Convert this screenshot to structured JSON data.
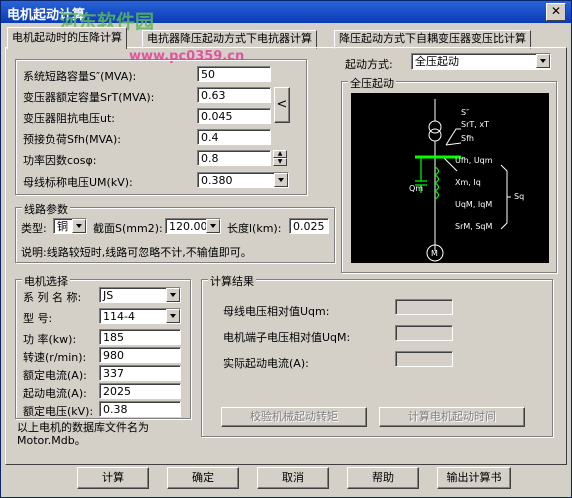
{
  "window": {
    "title": "电机起动计算",
    "close_glyph": "✕"
  },
  "watermark": {
    "text": "河东软件园",
    "url": "www.pc0359.cn"
  },
  "tabs": [
    {
      "label": "电机起动时的压降计算",
      "active": true
    },
    {
      "label": "电抗器降压起动方式下电抗器计算",
      "active": false
    },
    {
      "label": "降压起动方式下自耦变压器变压比计算",
      "active": false
    }
  ],
  "params": {
    "short_circuit_label": "系统短路容量S″(MVA):",
    "short_circuit_value": "50",
    "transformer_cap_label": "变压器额定容量SrT(MVA):",
    "transformer_cap_value": "0.63",
    "transformer_imp_label": "变压器阻抗电压ut:",
    "transformer_imp_value": "0.045",
    "preload_label": "预接负荷Sfh(MVA):",
    "preload_value": "0.4",
    "power_factor_label": "功率因数cosφ:",
    "power_factor_value": "0.8",
    "bus_voltage_label": "母线标称电压UM(kV):",
    "bus_voltage_value": "0.380",
    "side_button": "<"
  },
  "start_mode": {
    "label": "起动方式:",
    "value": "全压起动",
    "group_title": "全压起动"
  },
  "diagram_labels": {
    "s": "S″",
    "srt": "SrT, xT",
    "sfh": "Sfh",
    "ufh": "Ufh, Uqm",
    "xm": "Xm, Iq",
    "uqm": "UqM, IqM",
    "srm": "SrM, SqM",
    "sq": "Sq",
    "qm": "Qm",
    "m": "M"
  },
  "line": {
    "group_title": "线路参数",
    "type_label": "类型:",
    "type_value": "铜",
    "section_label": "截面S(mm2):",
    "section_value": "120.00",
    "length_label": "长度l(km):",
    "length_value": "0.025",
    "note": "说明:线路较短时,线路可忽略不计,不输值即可。"
  },
  "motor": {
    "group_title": "电机选择",
    "series_label": "系 列 名 称:",
    "series_value": "JS",
    "model_label": "型      号:",
    "model_value": "114-4",
    "power_label": "功   率(kw):",
    "power_value": "185",
    "speed_label": "转速(r/min):",
    "speed_value": "980",
    "rated_current_label": "额定电流(A):",
    "rated_current_value": "337",
    "start_current_label": "起动电流(A):",
    "start_current_value": "2025",
    "rated_voltage_label": "额定电压(kV):",
    "rated_voltage_value": "0.38",
    "db_note": "以上电机的数据库文件名为Motor.Mdb。"
  },
  "results": {
    "group_title": "计算结果",
    "bus_drop_label": "母线电压相对值Uqm:",
    "terminal_drop_label": "电机端子电压相对值UqM:",
    "start_current_label": "实际起动电流(A):",
    "check_torque": "校验机械起动转矩",
    "calc_time": "计算电机起动时间"
  },
  "bottom": {
    "calc": "计算",
    "ok": "确定",
    "cancel": "取消",
    "help": "帮助",
    "export": "输出计算书"
  }
}
